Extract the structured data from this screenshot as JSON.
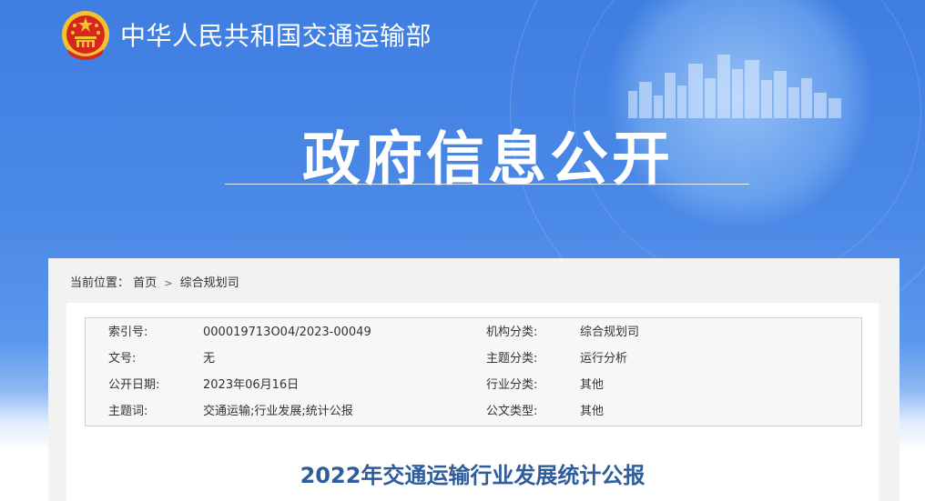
{
  "header": {
    "org_name": "中华人民共和国交通运输部",
    "hero_title": "政府信息公开"
  },
  "breadcrumb": {
    "label": "当前位置：",
    "items": [
      "首页",
      "综合规划司"
    ],
    "separator": ">"
  },
  "meta": {
    "rows": [
      {
        "k1": "索引号:",
        "v1": "000019713O04/2023-00049",
        "k2": "机构分类:",
        "v2": "综合规划司"
      },
      {
        "k1": "文号:",
        "v1": "无",
        "k2": "主题分类:",
        "v2": "运行分析"
      },
      {
        "k1": "公开日期:",
        "v1": "2023年06月16日",
        "k2": "行业分类:",
        "v2": "其他"
      },
      {
        "k1": "主题词:",
        "v1": "交通运输;行业发展;统计公报",
        "k2": "公文类型:",
        "v2": "其他"
      }
    ]
  },
  "document": {
    "title": "2022年交通运输行业发展统计公报"
  },
  "colors": {
    "banner_blue": "#3f7ee2",
    "title_blue": "#2f5d9b",
    "panel_gray": "#f2f2f2"
  },
  "icons": {
    "emblem": "national-emblem-icon"
  }
}
